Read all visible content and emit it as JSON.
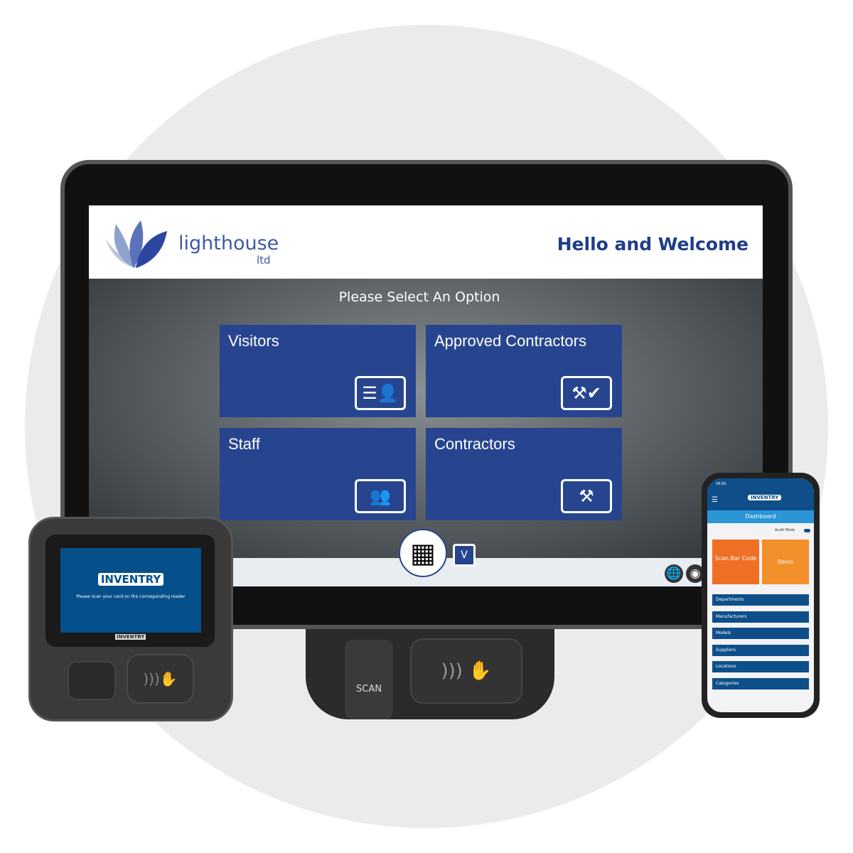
{
  "kiosk": {
    "brand": {
      "name": "lighthouse",
      "suffix": "ltd"
    },
    "welcome": "Hello and Welcome",
    "prompt": "Please Select An Option",
    "tiles": [
      {
        "label": "Visitors",
        "icon": "id-card-icon"
      },
      {
        "label": "Approved Contractors",
        "icon": "tools-check-icon"
      },
      {
        "label": "Staff",
        "icon": "group-icon"
      },
      {
        "label": "Contractors",
        "icon": "tools-icon"
      }
    ],
    "scan_label": "SCAN"
  },
  "reader": {
    "logo": "INVENTRY",
    "message": "Please scan your card on the corresponding reader",
    "brand": "INVENTRY"
  },
  "phone": {
    "time": "09:00",
    "logo": "INVENTRY",
    "title": "Dashboard",
    "audit_mode": "Audit Mode",
    "tiles": [
      "Scan Bar Code",
      "Items"
    ],
    "menu": [
      "Departments",
      "Manufacturers",
      "Models",
      "Suppliers",
      "Locations",
      "Categories"
    ],
    "colors": {
      "header": "#0e4f8a",
      "dashboard": "#2a96d6",
      "scan": "#ef6f24",
      "items": "#f2902c"
    }
  },
  "colors": {
    "tile": "#27458f",
    "brand_text": "#1f3d8a"
  }
}
